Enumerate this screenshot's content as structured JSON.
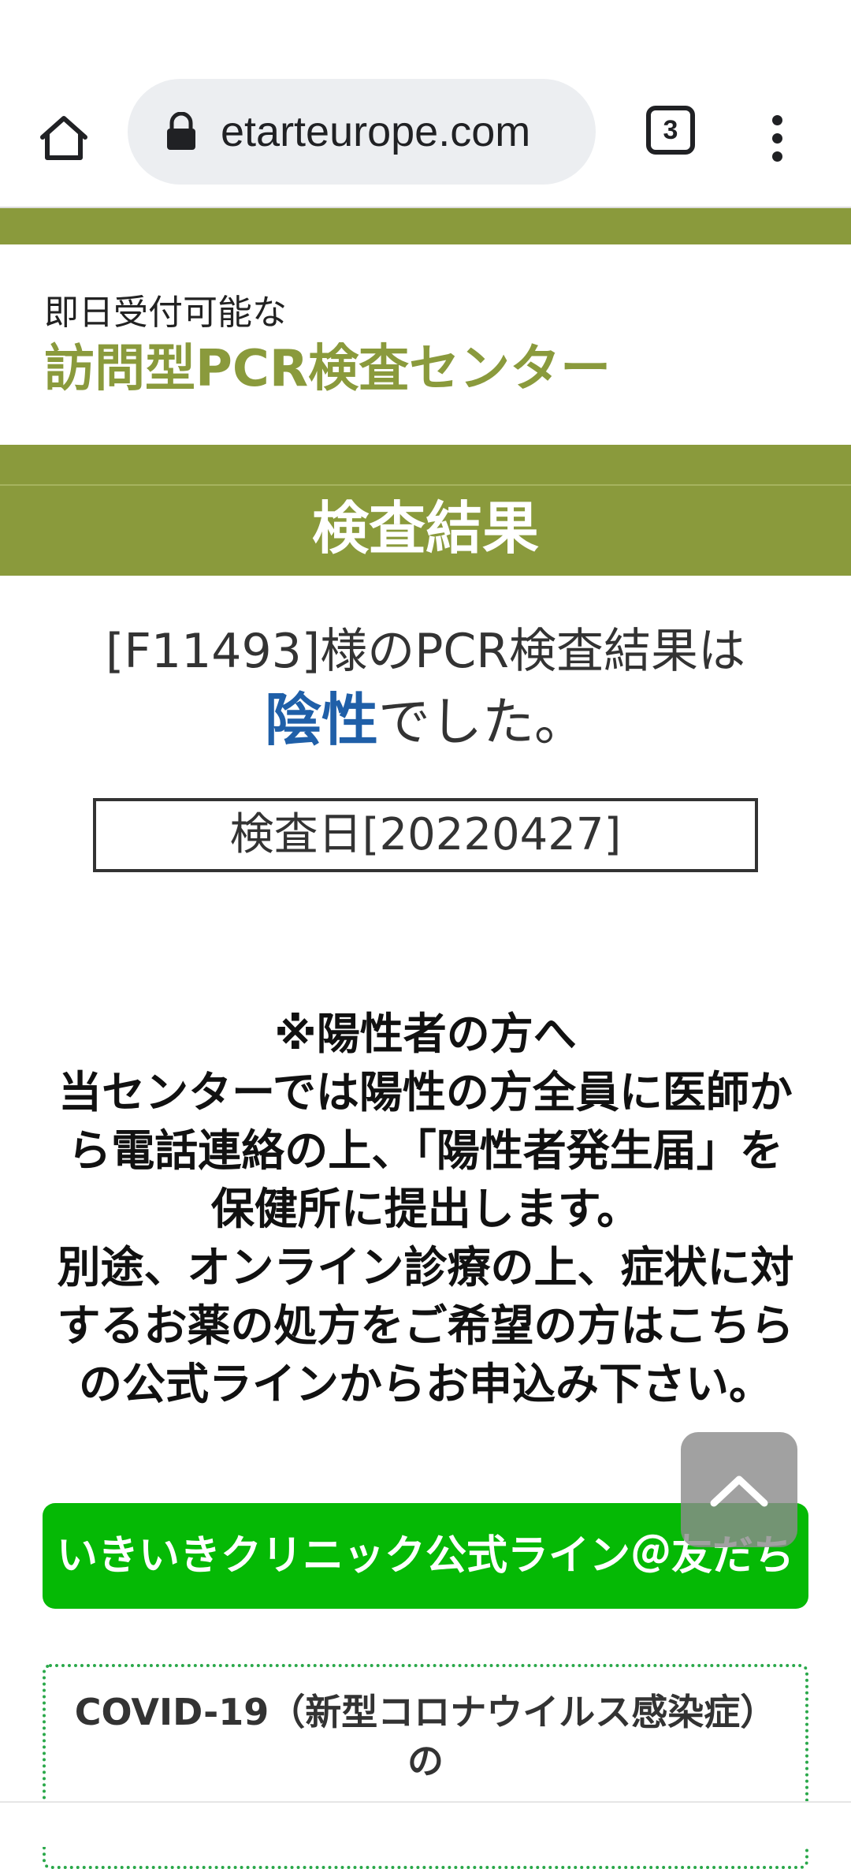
{
  "browser": {
    "url": "etarteurope.com",
    "tab_count": "3"
  },
  "header": {
    "subtitle": "即日受付可能な",
    "title": "訪問型PCR検査センター"
  },
  "result": {
    "section_title": "検査結果",
    "line1": "[F11493]様のPCR検査結果は",
    "status": "陰性",
    "line2_suffix": "でした。",
    "test_date": "検査日[20220427]"
  },
  "notice": {
    "heading": "※陽性者の方へ",
    "body1": "当センターでは陽性の方全員に医師から電話連絡の上、「陽性者発生届」を保健所に提出します。",
    "body2": "別途、オンライン診療の上、症状に対するお薬の処方をご希望の方はこちらの公式ラインからお申込み下さい。"
  },
  "line_button": {
    "label": "いきいきクリニック公式ライン＠友だち"
  },
  "covid_box": {
    "line1": "COVID-19（新型コロナウイルス感染症）の"
  },
  "colors": {
    "brand_olive": "#8a9a3c",
    "negative_blue": "#1f5fa8",
    "line_green": "#05b905"
  },
  "icons": [
    "home-icon",
    "lock-icon",
    "tabs-icon",
    "more-vert-icon",
    "chevron-up-icon"
  ]
}
